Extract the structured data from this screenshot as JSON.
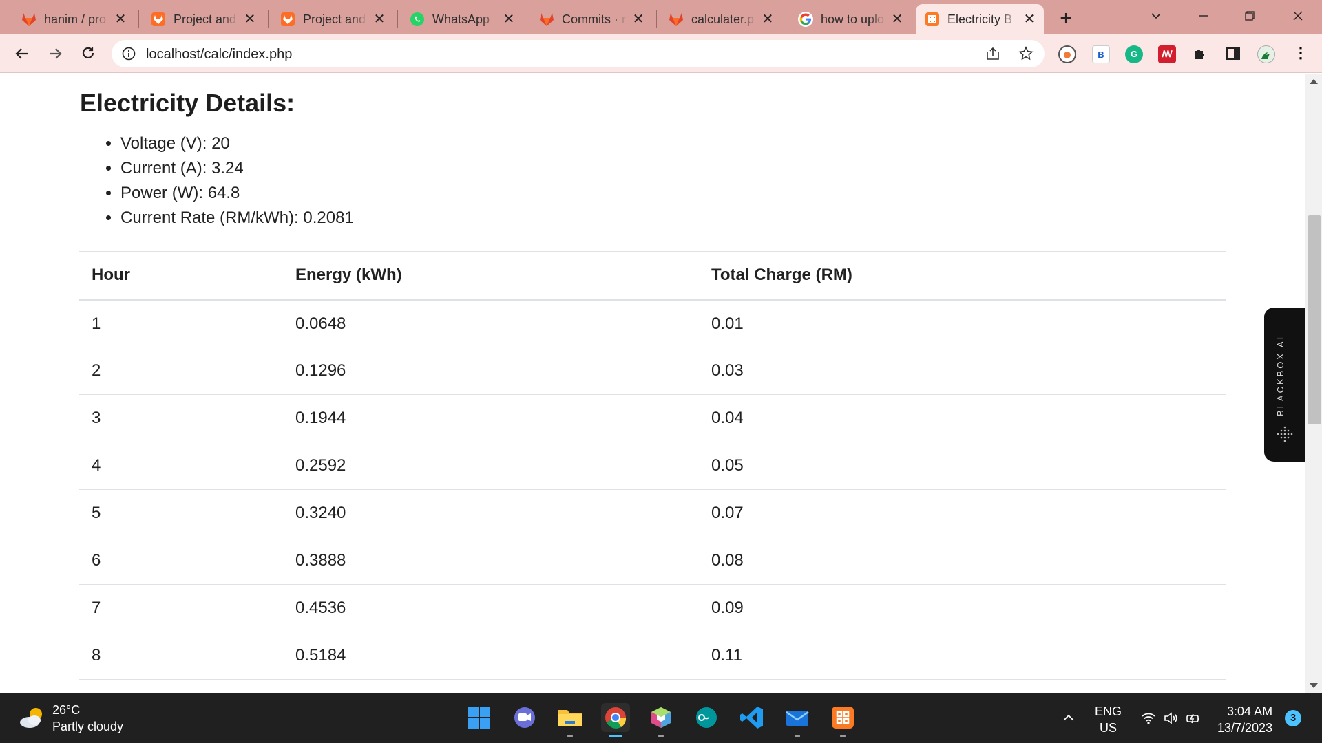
{
  "browser": {
    "tabs": [
      {
        "label": "hanim / pro",
        "icon": "gitlab-icon"
      },
      {
        "label": "Project and",
        "icon": "gitlab-icon"
      },
      {
        "label": "Project and",
        "icon": "gitlab-icon"
      },
      {
        "label": "WhatsApp",
        "icon": "whatsapp-icon"
      },
      {
        "label": "Commits · r",
        "icon": "gitlab-icon"
      },
      {
        "label": "calculater.p",
        "icon": "gitlab-icon"
      },
      {
        "label": "how to uplo",
        "icon": "google-icon"
      },
      {
        "label": "Electricity B",
        "icon": "xampp-icon"
      }
    ],
    "active_tab_index": 7,
    "url": "localhost/calc/index.php"
  },
  "page": {
    "title": "Electricity Details:",
    "details": [
      {
        "label": "Voltage (V)",
        "value": "20"
      },
      {
        "label": "Current (A)",
        "value": "3.24"
      },
      {
        "label": "Power (W)",
        "value": "64.8"
      },
      {
        "label": "Current Rate (RM/kWh)",
        "value": "0.2081"
      }
    ],
    "table": {
      "headers": [
        "Hour",
        "Energy (kWh)",
        "Total Charge (RM)"
      ],
      "rows": [
        [
          "1",
          "0.0648",
          "0.01"
        ],
        [
          "2",
          "0.1296",
          "0.03"
        ],
        [
          "3",
          "0.1944",
          "0.04"
        ],
        [
          "4",
          "0.2592",
          "0.05"
        ],
        [
          "5",
          "0.3240",
          "0.07"
        ],
        [
          "6",
          "0.3888",
          "0.08"
        ],
        [
          "7",
          "0.4536",
          "0.09"
        ],
        [
          "8",
          "0.5184",
          "0.11"
        ]
      ]
    },
    "sidebar_widget": "BLACKBOX AI"
  },
  "taskbar": {
    "weather_temp": "26°C",
    "weather_desc": "Partly cloudy",
    "lang_line1": "ENG",
    "lang_line2": "US",
    "time": "3:04 AM",
    "date": "13/7/2023",
    "notification_count": "3"
  },
  "colors": {
    "tabstrip": "#d9a09c",
    "toolbar": "#fbe7e5",
    "taskbar": "#202020",
    "accent": "#4cc2ff"
  }
}
